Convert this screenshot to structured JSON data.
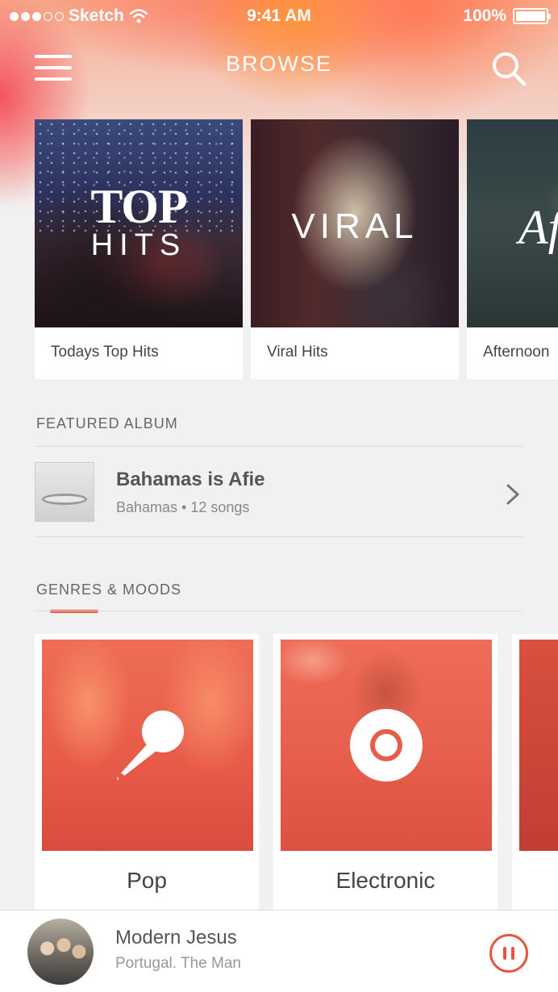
{
  "status_bar": {
    "carrier": "Sketch",
    "time": "9:41 AM",
    "battery": "100%"
  },
  "nav": {
    "title": "BROWSE"
  },
  "playlists": [
    {
      "label": "Todays Top Hits",
      "art_line1": "TOP",
      "art_line2": "HITS"
    },
    {
      "label": "Viral Hits",
      "art_line1": "VIRAL"
    },
    {
      "label": "Afternoon",
      "art_line1": "Af"
    }
  ],
  "featured": {
    "section_title": "FEATURED ALBUM",
    "album_title": "Bahamas is Afie",
    "album_subtitle": "Bahamas • 12 songs"
  },
  "genres": {
    "section_title": "GENRES & MOODS",
    "items": [
      {
        "label": "Pop",
        "icon": "microphone-icon"
      },
      {
        "label": "Electronic",
        "icon": "record-icon"
      },
      {
        "label": "",
        "icon": ""
      }
    ]
  },
  "player": {
    "title": "Modern Jesus",
    "artist": "Portugal. The Man",
    "state": "playing"
  },
  "colors": {
    "accent": "#e8553f"
  }
}
